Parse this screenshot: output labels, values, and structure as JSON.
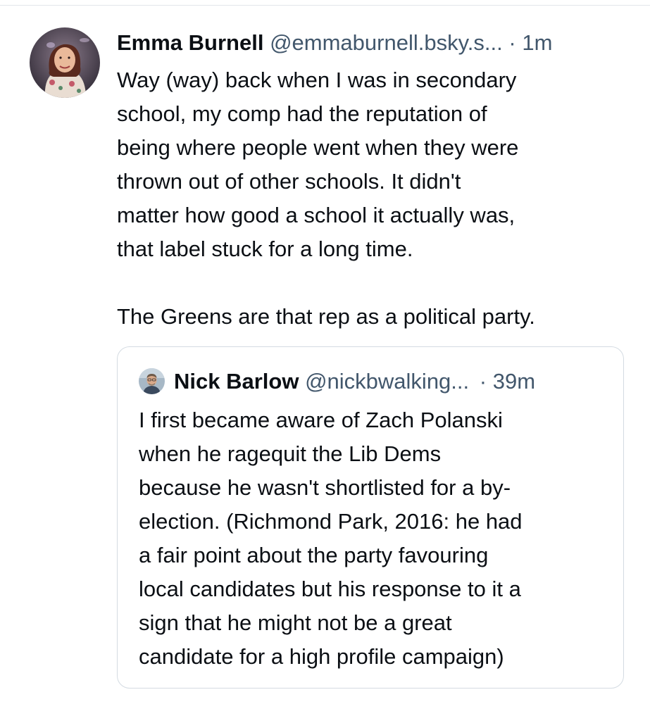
{
  "post": {
    "author": {
      "name": "Emma Burnell",
      "handle": "@emmaburnell.bsky.s..."
    },
    "separator": "·",
    "timestamp": "1m",
    "text_paragraphs": [
      "Way (way) back when I was in secondary\nschool, my comp had the reputation of\nbeing where people went when they were\nthrown out of other schools. It didn't\nmatter how good a school it actually was,\nthat label stuck for a long time.",
      "The Greens are that rep as a political party."
    ]
  },
  "quote": {
    "author": {
      "name": "Nick Barlow",
      "handle": "@nickbwalking..."
    },
    "separator": "·",
    "timestamp": "39m",
    "text": "I first became aware of Zach Polanski\nwhen he ragequit the Lib Dems\nbecause he wasn't shortlisted for a by-\nelection. (Richmond Park, 2016: he had\na fair point about the party favouring\nlocal candidates but his response to it a\nsign that he might not be a great\ncandidate for a high profile campaign)"
  },
  "colors": {
    "text_primary": "#0b0f14",
    "text_secondary": "#42576c",
    "card_border": "#d4dbe2",
    "divider": "#e3e6ea",
    "background": "#ffffff"
  },
  "icons": {
    "post_avatar": "user-avatar-photo",
    "quote_avatar": "user-avatar-photo"
  }
}
